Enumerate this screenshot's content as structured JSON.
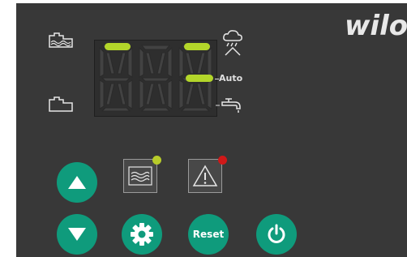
{
  "brand": {
    "logo_text": "wilo"
  },
  "display": {
    "mode_label": "Auto",
    "icons": {
      "top_left": "tank-full-icon",
      "bottom_left": "tank-empty-icon",
      "top_right": "cloud-rain-icon",
      "bottom_right": "tap-icon"
    }
  },
  "buttons": {
    "up": "arrow-up-icon",
    "down": "arrow-down-icon",
    "settings": "gear-icon",
    "reset_label": "Reset",
    "power": "power-icon",
    "pump_status": "pump-wave-icon",
    "alarm": "warning-icon"
  },
  "leds": {
    "pump_status_color": "#b8cc2a",
    "alarm_color": "#d01818"
  },
  "colors": {
    "panel": "#383838",
    "button_teal": "#0f9b7c",
    "segment_on": "#b3d62a"
  }
}
